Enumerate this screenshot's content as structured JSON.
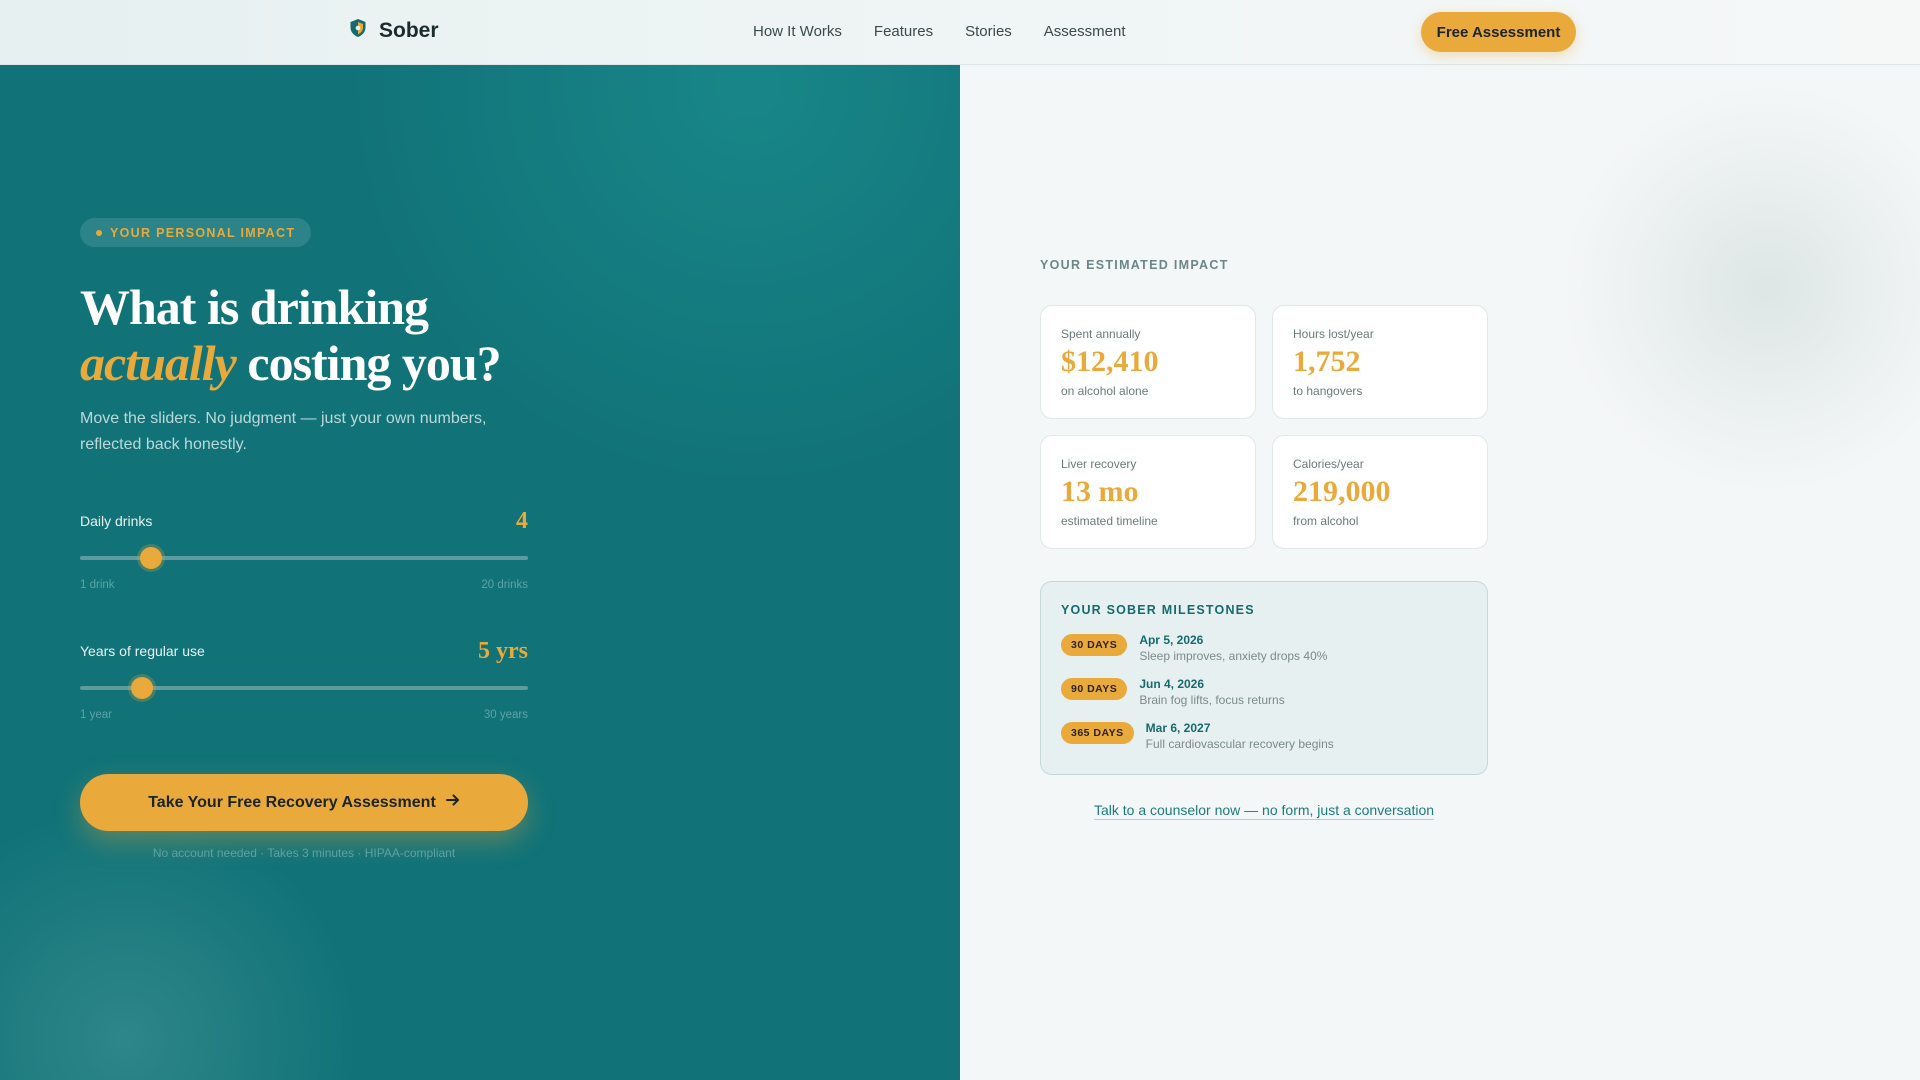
{
  "nav": {
    "brand": "Sober",
    "links": [
      "How It Works",
      "Features",
      "Stories",
      "Assessment"
    ],
    "cta": "Free Assessment"
  },
  "hero": {
    "badge": "YOUR PERSONAL IMPACT",
    "headline_line1": "What is drinking",
    "headline_accent": "actually",
    "headline_rest": "costing you?",
    "subtitle": "Move the sliders. No judgment — just your own numbers, reflected back honestly."
  },
  "sliders": [
    {
      "label": "Daily drinks",
      "value_text": "4",
      "value": 4,
      "min": 1,
      "max": 20,
      "min_label": "1 drink",
      "max_label": "20 drinks"
    },
    {
      "label": "Years of regular use",
      "value_text": "5 yrs",
      "value": 5,
      "min": 1,
      "max": 30,
      "min_label": "1 year",
      "max_label": "30 years"
    }
  ],
  "cta": {
    "label": "Take Your Free Recovery Assessment",
    "fineprint": "No account needed · Takes 3 minutes · HIPAA-compliant"
  },
  "impact": {
    "title": "YOUR ESTIMATED IMPACT",
    "cards": [
      {
        "label": "Spent annually",
        "value": "$12,410",
        "sub": "on alcohol alone"
      },
      {
        "label": "Hours lost/year",
        "value": "1,752",
        "sub": "to hangovers"
      },
      {
        "label": "Liver recovery",
        "value": "13 mo",
        "sub": "estimated timeline"
      },
      {
        "label": "Calories/year",
        "value": "219,000",
        "sub": "from alcohol"
      }
    ]
  },
  "milestones": {
    "title": "YOUR SOBER MILESTONES",
    "items": [
      {
        "badge": "30 DAYS",
        "date": "Apr 5, 2026",
        "desc": "Sleep improves, anxiety drops 40%"
      },
      {
        "badge": "90 DAYS",
        "date": "Jun 4, 2026",
        "desc": "Brain fog lifts, focus returns"
      },
      {
        "badge": "365 DAYS",
        "date": "Mar 6, 2027",
        "desc": "Full cardiovascular recovery begins"
      }
    ]
  },
  "counselor_link": "Talk to a counselor now — no form, just a conversation",
  "colors": {
    "teal": "#117378",
    "accent": "#e9a93b",
    "dark_teal": "#166a6e"
  },
  "icons": {
    "logo": "shield-logo-icon",
    "cta_arrow": "arrow-right-icon"
  }
}
